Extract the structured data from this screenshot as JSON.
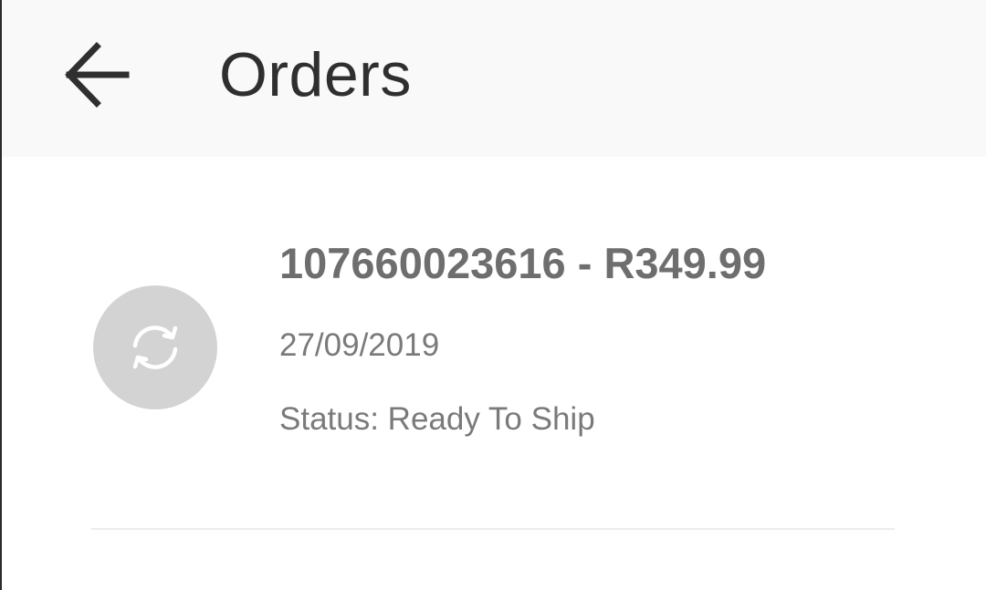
{
  "header": {
    "title": "Orders",
    "back_icon": "arrow-left-icon"
  },
  "orders": [
    {
      "title": "107660023616 - R349.99",
      "date": "27/09/2019",
      "status": "Status: Ready To Ship",
      "icon": "refresh-icon"
    }
  ],
  "colors": {
    "header_background": "#f9f9f9",
    "title_text": "#2f2f2f",
    "order_title_text": "#6e6e6e",
    "secondary_text": "#7a7a7a",
    "avatar_background": "#d3d3d3",
    "divider": "#ececec"
  }
}
